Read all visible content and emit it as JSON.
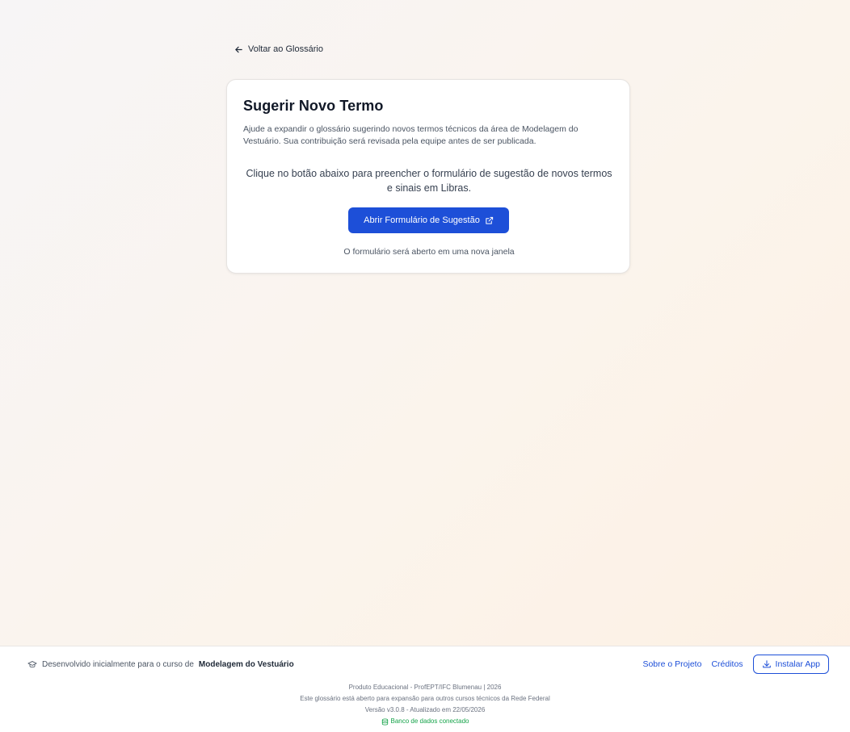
{
  "nav": {
    "back_label": "Voltar ao Glossário"
  },
  "card": {
    "title": "Sugerir Novo Termo",
    "description": "Ajude a expandir o glossário sugerindo novos termos técnicos da área de Modelagem do Vestuário. Sua contribuição será revisada pela equipe antes de ser publicada.",
    "instruction": "Clique no botão abaixo para preencher o formulário de sugestão de novos termos e sinais em Libras.",
    "button_label": "Abrir Formulário de Sugestão",
    "note": "O formulário será aberto em uma nova janela"
  },
  "footer": {
    "dev_prefix": "Desenvolvido inicialmente para o curso de",
    "course_name": "Modelagem do Vestuário",
    "about_link": "Sobre o Projeto",
    "credits_link": "Créditos",
    "install_label": "Instalar App",
    "product_line": "Produto Educacional - ProfEPT/IFC Blumenau | 2026",
    "expansion_line": "Este glossário está aberto para expansão para outros cursos técnicos da Rede Federal",
    "version_line": "Versão v3.0.8 - Atualizado em 22/05/2026",
    "db_status": "Banco de dados conectado"
  },
  "colors": {
    "primary": "#1d4fd8",
    "success": "#16a34a"
  },
  "icons": {
    "back": "arrow-left-icon",
    "external": "external-link-icon",
    "graduation": "graduation-cap-icon",
    "download": "download-icon",
    "database": "database-icon"
  }
}
